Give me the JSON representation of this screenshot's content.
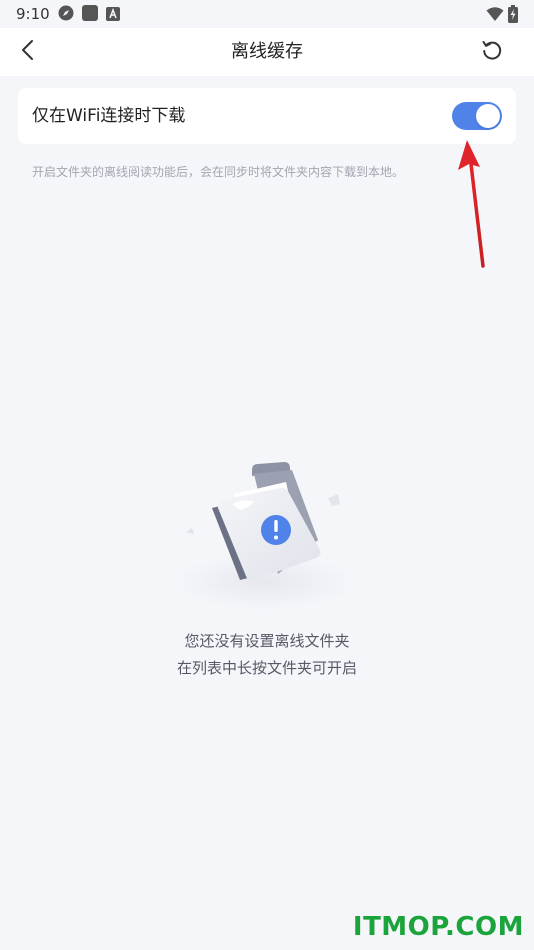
{
  "status_bar": {
    "time": "9:10",
    "icons_left": [
      "compass-icon",
      "square-app-icon",
      "a-badge-icon"
    ],
    "icons_right": [
      "wifi-icon",
      "battery-charging-icon"
    ]
  },
  "nav": {
    "title": "离线缓存",
    "back_icon": "chevron-left-icon",
    "refresh_icon": "refresh-icon"
  },
  "setting": {
    "label": "仅在WiFi连接时下载",
    "toggle_on": true,
    "toggle_color": "#4f83ea"
  },
  "hint": "开启文件夹的离线阅读功能后，会在同步时将文件夹内容下载到本地。",
  "empty_state": {
    "icon": "folder-warning-icon",
    "line1": "您还没有设置离线文件夹",
    "line2": "在列表中长按文件夹可开启"
  },
  "watermark": "ITMOP.COM",
  "colors": {
    "accent": "#4f83ea",
    "background": "#f5f6fa",
    "arrow": "#e0252a",
    "watermark": "#1ca43c"
  }
}
